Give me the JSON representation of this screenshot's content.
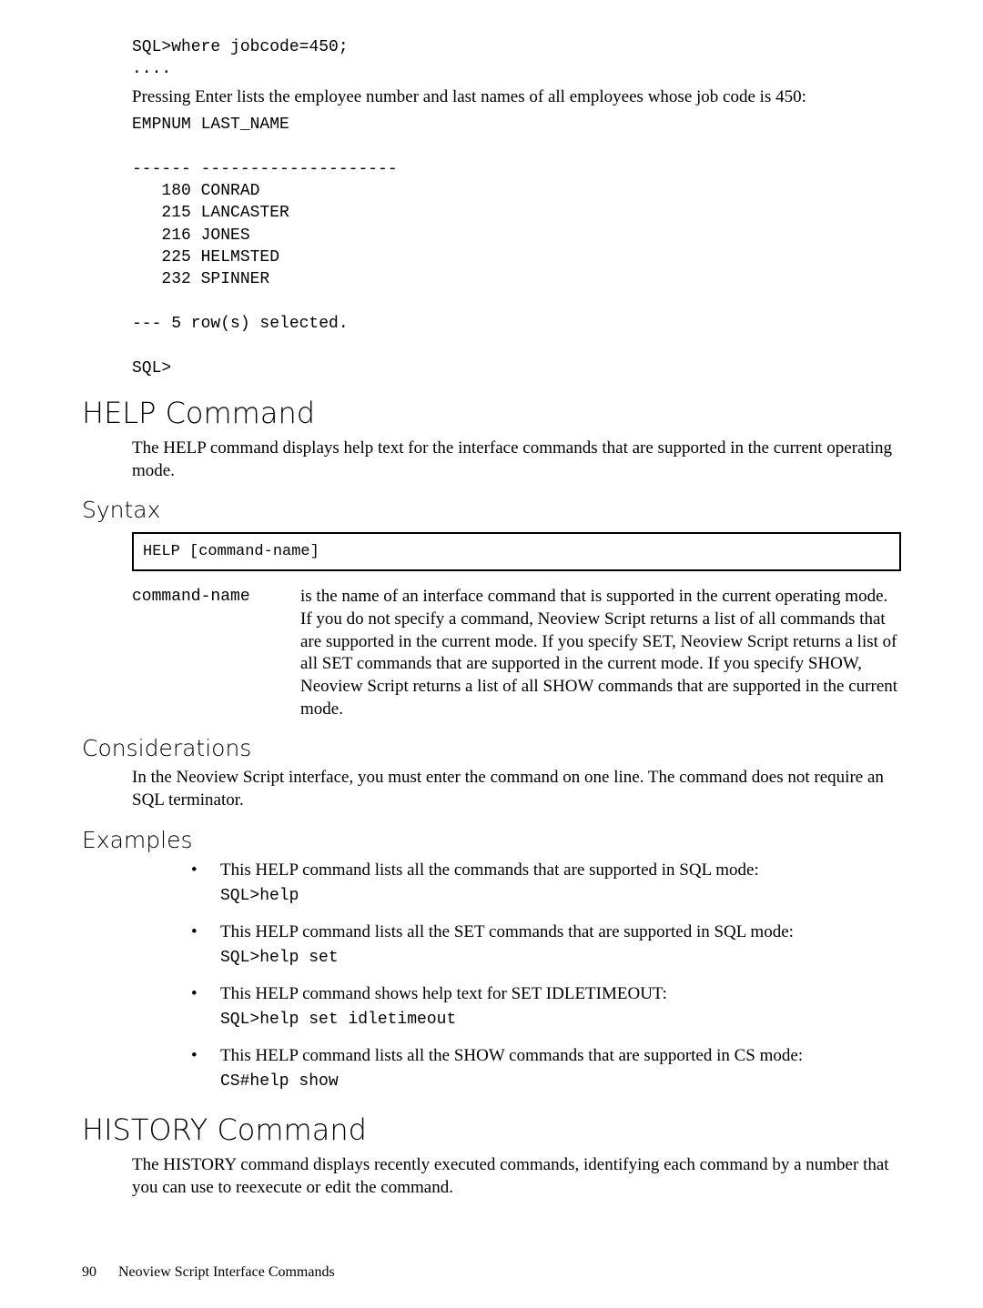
{
  "codeblock1": "SQL>where jobcode=450;\n....",
  "para1": "Pressing Enter lists the employee number and last names of all employees whose job code is 450:",
  "codeblock2": "EMPNUM LAST_NAME\n\n------ --------------------\n   180 CONRAD\n   215 LANCASTER\n   216 JONES\n   225 HELMSTED\n   232 SPINNER\n\n--- 5 row(s) selected.\n\nSQL>",
  "help": {
    "title": "HELP Command",
    "intro": "The HELP command displays help text for the interface commands that are supported in the current operating mode.",
    "syntax_title": "Syntax",
    "syntax_box": "HELP [command-name]",
    "term": "command-name",
    "term_desc": "is the name of an interface command that is supported in the current operating mode. If you do not specify a command, Neoview Script returns a list of all commands that are supported in the current mode. If you specify SET, Neoview Script returns a list of all SET commands that are supported in the current mode. If you specify SHOW, Neoview Script returns a list of all SHOW commands that are supported in the current mode.",
    "cons_title": "Considerations",
    "cons_text": "In the Neoview Script interface, you must enter the command on one line. The command does not require an SQL terminator.",
    "ex_title": "Examples",
    "examples": [
      {
        "text": "This HELP command lists all the commands that are supported in SQL mode:",
        "code": "SQL>help"
      },
      {
        "text": "This HELP command lists all the SET commands that are supported in SQL mode:",
        "code": "SQL>help set"
      },
      {
        "text": "This HELP command shows help text for SET IDLETIMEOUT:",
        "code": "SQL>help set idletimeout"
      },
      {
        "text": "This HELP command lists all the SHOW commands that are supported in CS mode:",
        "code": "CS#help show"
      }
    ]
  },
  "history": {
    "title": "HISTORY Command",
    "intro": "The HISTORY command displays recently executed commands, identifying each command by a number that you can use to reexecute or edit the command."
  },
  "footer": {
    "page": "90",
    "title": "Neoview Script Interface Commands"
  }
}
